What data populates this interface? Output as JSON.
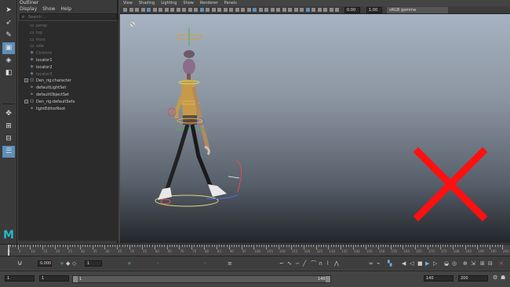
{
  "outliner": {
    "title": "Outliner",
    "menu": [
      "Display",
      "Show",
      "Help"
    ],
    "search_placeholder": "Search...",
    "items": [
      {
        "label": "persp",
        "dim": true,
        "icon": "camera-icon",
        "expand": false
      },
      {
        "label": "top",
        "dim": true,
        "icon": "camera-icon",
        "expand": false
      },
      {
        "label": "front",
        "dim": true,
        "icon": "camera-icon",
        "expand": false
      },
      {
        "label": "side",
        "dim": true,
        "icon": "camera-icon",
        "expand": false
      },
      {
        "label": "Ctrlshrd",
        "dim": true,
        "icon": "locator-icon",
        "expand": false
      },
      {
        "label": "locator1",
        "dim": false,
        "icon": "locator-icon",
        "expand": false
      },
      {
        "label": "locator2",
        "dim": false,
        "icon": "locator-icon",
        "expand": false
      },
      {
        "label": "locator3",
        "dim": true,
        "icon": "locator-icon",
        "expand": false
      },
      {
        "label": "Den_rig:character",
        "dim": false,
        "icon": "group-icon",
        "expand": true
      },
      {
        "label": "defaultLightSet",
        "dim": false,
        "icon": "set-icon",
        "expand": false
      },
      {
        "label": "defaultObjectSet",
        "dim": false,
        "icon": "set-icon",
        "expand": false
      },
      {
        "label": "Den_rig:defaultSets",
        "dim": false,
        "icon": "group-icon",
        "expand": true
      },
      {
        "label": "lightEditorRoot",
        "dim": false,
        "icon": "set-icon",
        "expand": false
      }
    ]
  },
  "viewport": {
    "menu": [
      "View",
      "Shading",
      "Lighting",
      "Show",
      "Renderer",
      "Panels"
    ],
    "field1": "0.00",
    "field2": "1.00",
    "color_space": "sRGB gamma"
  },
  "timeslider": {
    "ticks": [
      "1",
      "5",
      "10",
      "15",
      "20",
      "25",
      "30",
      "35",
      "40",
      "45",
      "50",
      "55",
      "60",
      "65",
      "70",
      "75",
      "80",
      "85",
      "90",
      "95",
      "100",
      "105",
      "110",
      "115",
      "120",
      "125",
      "130",
      "135",
      "140",
      "145",
      "150",
      "155",
      "160",
      "165",
      "170",
      "175",
      "180",
      "185",
      "190",
      "195",
      "200"
    ],
    "current_frame": "1"
  },
  "anim": {
    "value_field": "0.000",
    "frame_field": "1"
  },
  "range": {
    "start": "1",
    "start2": "1",
    "bar_start": "1",
    "bar_end": "140",
    "end": "140",
    "end2": "200"
  },
  "icons": {
    "select": "select-arrow-icon",
    "lasso": "lasso-icon",
    "paint": "paint-select-icon",
    "move": "move-tool-icon",
    "rotate": "rotate-tool-icon",
    "scale": "scale-tool-icon",
    "logo": "maya-logo-icon",
    "red_x": "red-x-mark"
  },
  "colors": {
    "accent": "#5d8fb8",
    "x_mark": "#ff1010",
    "logo": "#28b7c8"
  }
}
